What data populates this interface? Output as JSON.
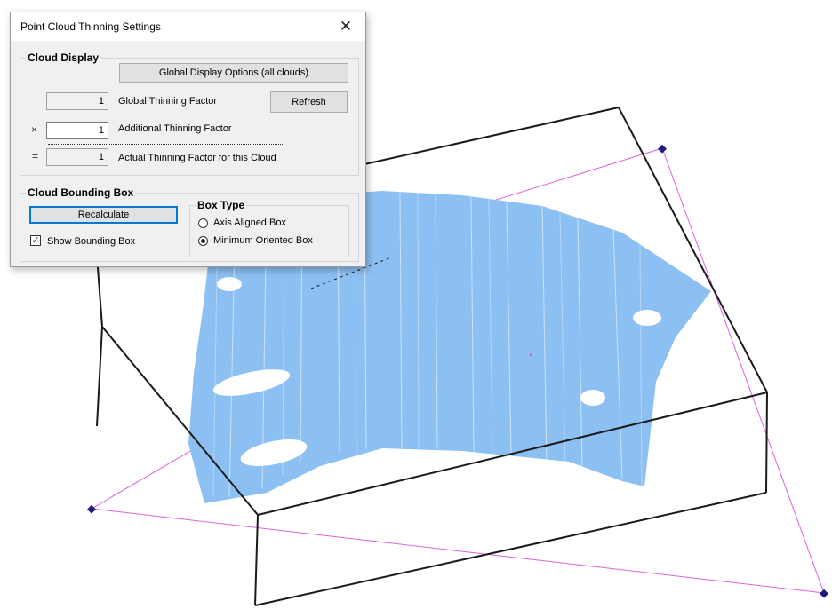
{
  "dialog": {
    "title": "Point Cloud Thinning Settings",
    "close_glyph": "✕"
  },
  "cloud_display": {
    "label": "Cloud Display",
    "global_options_button": "Global Display Options (all clouds)",
    "global_thinning_value": "1",
    "global_thinning_label": "Global Thinning Factor",
    "refresh_button": "Refresh",
    "multiply_symbol": "×",
    "additional_thinning_value": "1",
    "additional_thinning_label": "Additional Thinning Factor",
    "equals_symbol": "=",
    "actual_thinning_value": "1",
    "actual_thinning_label": "Actual Thinning Factor for this Cloud"
  },
  "bounding_box": {
    "label": "Cloud Bounding Box",
    "recalculate_button": "Recalculate",
    "show_checkbox_label": "Show Bounding Box",
    "show_checked": true,
    "box_type": {
      "label": "Box Type",
      "options": [
        "Axis Aligned Box",
        "Minimum Oriented Box"
      ],
      "selected": "Minimum Oriented Box"
    }
  },
  "viewport": {
    "point_cloud_color": "#8cbff2",
    "box_edge_color": "#1a1a1a",
    "guide_line_color": "#e060e0",
    "handle_color": "#1a1a80",
    "handle_icon": "crosshair-handle"
  }
}
